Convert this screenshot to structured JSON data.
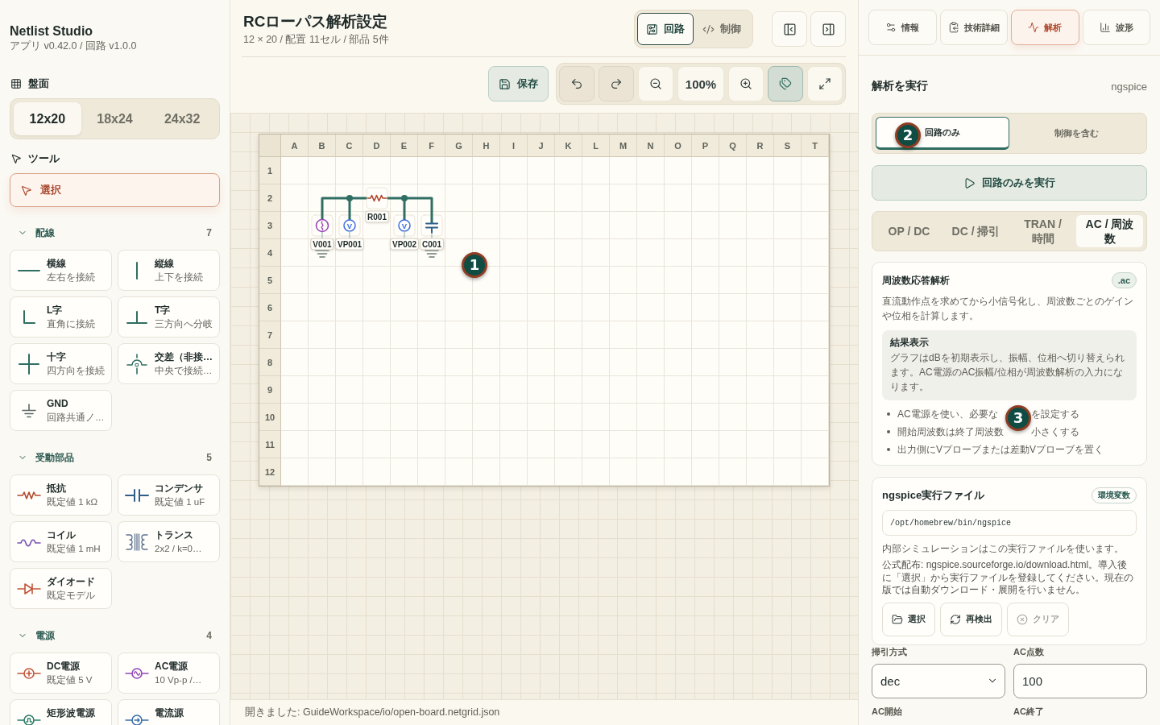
{
  "app": {
    "name": "Netlist Studio",
    "version": "アプリ v0.42.0 / 回路 v1.0.0"
  },
  "board_size": {
    "title": "盤面",
    "options": [
      {
        "label": "12x20",
        "selected": true
      },
      {
        "label": "18x24",
        "selected": false
      },
      {
        "label": "24x32",
        "selected": false
      }
    ]
  },
  "tools": {
    "title": "ツール",
    "items": [
      {
        "label": "選択",
        "selected": true
      }
    ]
  },
  "palette": [
    {
      "title": "配線",
      "count": "7",
      "expanded": true,
      "items": [
        {
          "kind": "h_wire",
          "name": "横線",
          "hint": "左右を接続"
        },
        {
          "kind": "v_wire",
          "name": "縦線",
          "hint": "上下を接続"
        },
        {
          "kind": "l_wire",
          "name": "L字",
          "hint": "直角に接続"
        },
        {
          "kind": "t_wire",
          "name": "T字",
          "hint": "三方向へ分岐"
        },
        {
          "kind": "cross",
          "name": "十字",
          "hint": "四方向を接続"
        },
        {
          "kind": "crossover",
          "name": "交差（非接…",
          "hint": "中央で接続…"
        },
        {
          "kind": "gnd",
          "name": "GND",
          "hint": "回路共通ノ…"
        }
      ]
    },
    {
      "title": "受動部品",
      "count": "5",
      "expanded": true,
      "items": [
        {
          "kind": "resistor",
          "name": "抵抗",
          "hint": "既定値 1 kΩ"
        },
        {
          "kind": "capacitor",
          "name": "コンデンサ",
          "hint": "既定値 1 uF"
        },
        {
          "kind": "inductor",
          "name": "コイル",
          "hint": "既定値 1 mH"
        },
        {
          "kind": "transformer",
          "name": "トランス",
          "hint": "2x2 / k=0…"
        },
        {
          "kind": "diode",
          "name": "ダイオード",
          "hint": "既定モデル"
        }
      ]
    },
    {
      "title": "電源",
      "count": "4",
      "expanded": true,
      "items": [
        {
          "kind": "dc_source",
          "name": "DC電源",
          "hint": "既定値 5 V"
        },
        {
          "kind": "ac_source",
          "name": "AC電源",
          "hint": "10 Vp-p /…"
        },
        {
          "kind": "pulse_source",
          "name": "矩形波電源"
        },
        {
          "kind": "current_source",
          "name": "電流源"
        }
      ]
    }
  ],
  "document": {
    "title": "RCローパス解析設定",
    "summary": "12 × 20 / 配置 11セル / 部品 5件"
  },
  "view_modes": [
    {
      "kind": "circuit",
      "label": "回路",
      "selected": true
    },
    {
      "kind": "code",
      "label": "制御",
      "selected": false
    }
  ],
  "toolbar": {
    "save": "保存",
    "zoom": "100%",
    "labels_on": true
  },
  "board": {
    "columns": [
      "A",
      "B",
      "C",
      "D",
      "E",
      "F",
      "G",
      "H",
      "I",
      "J",
      "K",
      "L",
      "M",
      "N",
      "O",
      "P",
      "Q",
      "R",
      "S",
      "T"
    ],
    "rows": [
      {
        "label": "1"
      },
      {
        "label": "2",
        "cells": [
          null,
          {
            "kind": "corner_right"
          },
          {
            "kind": "tee"
          },
          {
            "kind": "resistor",
            "label": "R001"
          },
          {
            "kind": "tee"
          },
          {
            "kind": "corner_left"
          }
        ]
      },
      {
        "label": "3",
        "cells": [
          null,
          {
            "kind": "ac_source",
            "label": "V001"
          },
          {
            "kind": "v_probe",
            "label": "VP001",
            "symbol": "V"
          },
          null,
          {
            "kind": "v_probe",
            "label": "VP002",
            "symbol": "V"
          },
          {
            "kind": "capacitor",
            "label": "C001"
          }
        ]
      },
      {
        "label": "4",
        "cells": [
          null,
          {
            "kind": "gnd"
          },
          null,
          null,
          null,
          {
            "kind": "gnd"
          }
        ]
      },
      {
        "label": "5"
      },
      {
        "label": "6"
      },
      {
        "label": "7"
      },
      {
        "label": "8"
      },
      {
        "label": "9"
      },
      {
        "label": "10"
      },
      {
        "label": "11"
      },
      {
        "label": "12"
      }
    ],
    "callout": "1"
  },
  "status": "開きました: GuideWorkspace/io/open-board.netgrid.json",
  "inspector": {
    "tabs": [
      {
        "kind": "info",
        "label": "情報",
        "selected": false
      },
      {
        "kind": "tech",
        "label": "技術詳細",
        "selected": false
      },
      {
        "kind": "analysis",
        "label": "解析",
        "selected": true
      },
      {
        "kind": "waveform",
        "label": "波形",
        "selected": false
      }
    ],
    "heading": "解析を実行",
    "engine": "ngspice",
    "scope": {
      "options": [
        {
          "label": "回路のみ",
          "selected": true
        },
        {
          "label": "制御を含む",
          "selected": false
        }
      ],
      "callout": "2"
    },
    "run_button": "回路のみを実行",
    "analysis_types": [
      {
        "label": "OP / DC",
        "selected": false
      },
      {
        "label": "DC / 掃引",
        "selected": false
      },
      {
        "label": "TRAN / 時間",
        "selected": false
      },
      {
        "label": "AC / 周波数",
        "selected": true
      }
    ],
    "analysis": {
      "title": "周波数応答解析",
      "directive": ".ac",
      "description": "直流動作点を求めてから小信号化し、周波数ごとのゲインや位相を計算します。",
      "result": {
        "title": "結果表示",
        "text": "グラフはdBを初期表示し、振幅、位相へ切り替えられます。AC電源のAC振幅/位相が周波数解析の入力になります。"
      },
      "tips": [
        {
          "parts": [
            "AC電源を使い、必要な",
            "を設定する"
          ]
        },
        {
          "parts": [
            "開始周波数は終了周波数",
            "小さくする"
          ]
        },
        {
          "parts": [
            "出力側にVプローブまたは差動Vプローブを置く"
          ]
        }
      ],
      "callout": "3"
    },
    "executable": {
      "title": "ngspice実行ファイル",
      "env_badge": "環境変数",
      "path": "/opt/homebrew/bin/ngspice",
      "note": "内部シミュレーションはこの実行ファイルを使います。",
      "source": "公式配布: ngspice.sourceforge.io/download.html。導入後に「選択」から実行ファイルを登録してください。現在の版では自動ダウンロード・展開を行いません。",
      "buttons": [
        {
          "kind": "browse",
          "label": "選択",
          "disabled": false
        },
        {
          "kind": "rescan",
          "label": "再検出",
          "disabled": false
        },
        {
          "kind": "clear",
          "label": "クリア",
          "disabled": true
        }
      ]
    },
    "fields": [
      {
        "kind": "select",
        "label": "掃引方式",
        "value": "dec"
      },
      {
        "kind": "input",
        "label": "AC点数",
        "value": "100"
      },
      {
        "kind": "heading",
        "label": "AC開始"
      },
      {
        "kind": "heading",
        "label": "AC終了"
      }
    ]
  }
}
